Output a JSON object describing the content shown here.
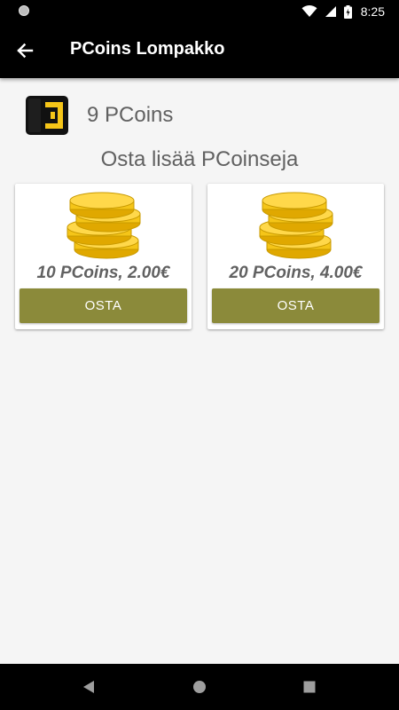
{
  "status_bar": {
    "time": "8:25",
    "icons": [
      "notification-dot-icon",
      "wifi-icon",
      "cellular-signal-icon",
      "battery-charging-icon"
    ]
  },
  "app_bar": {
    "title": "PCoins Lompakko",
    "back_icon": "arrow-back-icon"
  },
  "wallet": {
    "icon": "wallet-icon",
    "balance": "9 PCoins"
  },
  "store": {
    "heading": "Osta lisää PCoinseja",
    "products": [
      {
        "label": "10 PCoins, 2.00€",
        "button": "OSTA",
        "icon": "coin-stack-icon"
      },
      {
        "label": "20 PCoins, 4.00€",
        "button": "OSTA",
        "icon": "coin-stack-icon"
      }
    ]
  },
  "nav_bar": {
    "icons": [
      "nav-back-icon",
      "nav-home-icon",
      "nav-recents-icon"
    ]
  },
  "colors": {
    "accent_button": "#8b8a3a",
    "coin_gold": "#f5c518",
    "wallet_gold": "#f5c518",
    "app_bar": "#000000",
    "background": "#f5f5f5"
  }
}
